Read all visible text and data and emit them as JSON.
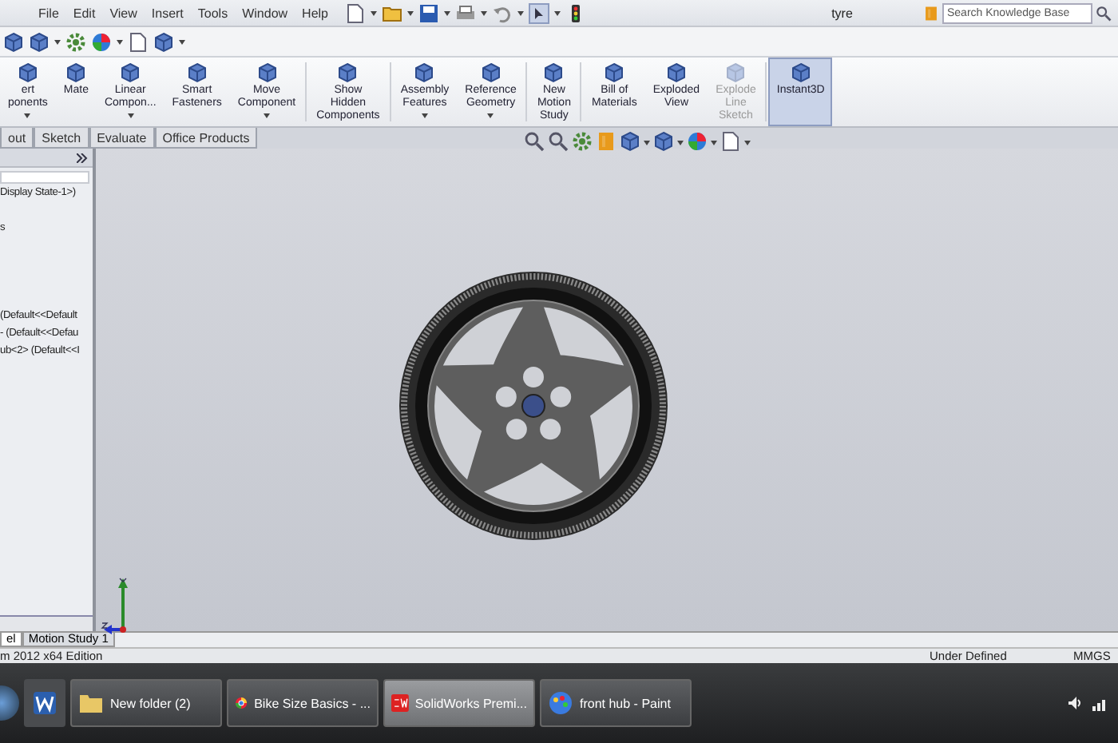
{
  "window": {
    "title": "tyre"
  },
  "menu": [
    "File",
    "Edit",
    "View",
    "Insert",
    "Tools",
    "Window",
    "Help"
  ],
  "search": {
    "placeholder": "Search Knowledge Base"
  },
  "ribbon": [
    {
      "label": "ert\nponents",
      "dropdown": true,
      "selected": false,
      "disabled": false
    },
    {
      "label": "Mate",
      "dropdown": false,
      "selected": false,
      "disabled": false
    },
    {
      "label": "Linear\nCompon...",
      "dropdown": true,
      "selected": false,
      "disabled": false
    },
    {
      "label": "Smart\nFasteners",
      "dropdown": false,
      "selected": false,
      "disabled": false
    },
    {
      "label": "Move\nComponent",
      "dropdown": true,
      "selected": false,
      "disabled": false
    },
    {
      "label": "Show\nHidden\nComponents",
      "dropdown": false,
      "selected": false,
      "disabled": false
    },
    {
      "label": "Assembly\nFeatures",
      "dropdown": true,
      "selected": false,
      "disabled": false
    },
    {
      "label": "Reference\nGeometry",
      "dropdown": true,
      "selected": false,
      "disabled": false
    },
    {
      "label": "New\nMotion\nStudy",
      "dropdown": false,
      "selected": false,
      "disabled": false
    },
    {
      "label": "Bill of\nMaterials",
      "dropdown": false,
      "selected": false,
      "disabled": false
    },
    {
      "label": "Exploded\nView",
      "dropdown": false,
      "selected": false,
      "disabled": false
    },
    {
      "label": "Explode\nLine\nSketch",
      "dropdown": false,
      "selected": false,
      "disabled": true
    },
    {
      "label": "Instant3D",
      "dropdown": false,
      "selected": true,
      "disabled": false
    }
  ],
  "tabs": [
    {
      "label": "out",
      "selected": false
    },
    {
      "label": "Sketch",
      "selected": false
    },
    {
      "label": "Evaluate",
      "selected": false
    },
    {
      "label": "Office Products",
      "selected": false
    }
  ],
  "feature_tree": {
    "items": [
      "Display State-1>)",
      "s",
      "(Default<<Default",
      "- (Default<<Defau",
      "ub<2> (Default<<I"
    ]
  },
  "bottom_tabs": [
    {
      "label": "el",
      "selected": true
    },
    {
      "label": "Motion Study 1",
      "selected": false
    }
  ],
  "status_bar": {
    "version": "m 2012 x64 Edition",
    "state": "Under Defined",
    "units": "MMGS"
  },
  "taskbar": [
    {
      "label": "New folder (2)",
      "kind": "folder",
      "active": false
    },
    {
      "label": "Bike Size Basics - ...",
      "kind": "browser",
      "active": false
    },
    {
      "label": "SolidWorks Premi...",
      "kind": "cad",
      "active": true
    },
    {
      "label": "front hub - Paint",
      "kind": "paint",
      "active": false
    }
  ]
}
